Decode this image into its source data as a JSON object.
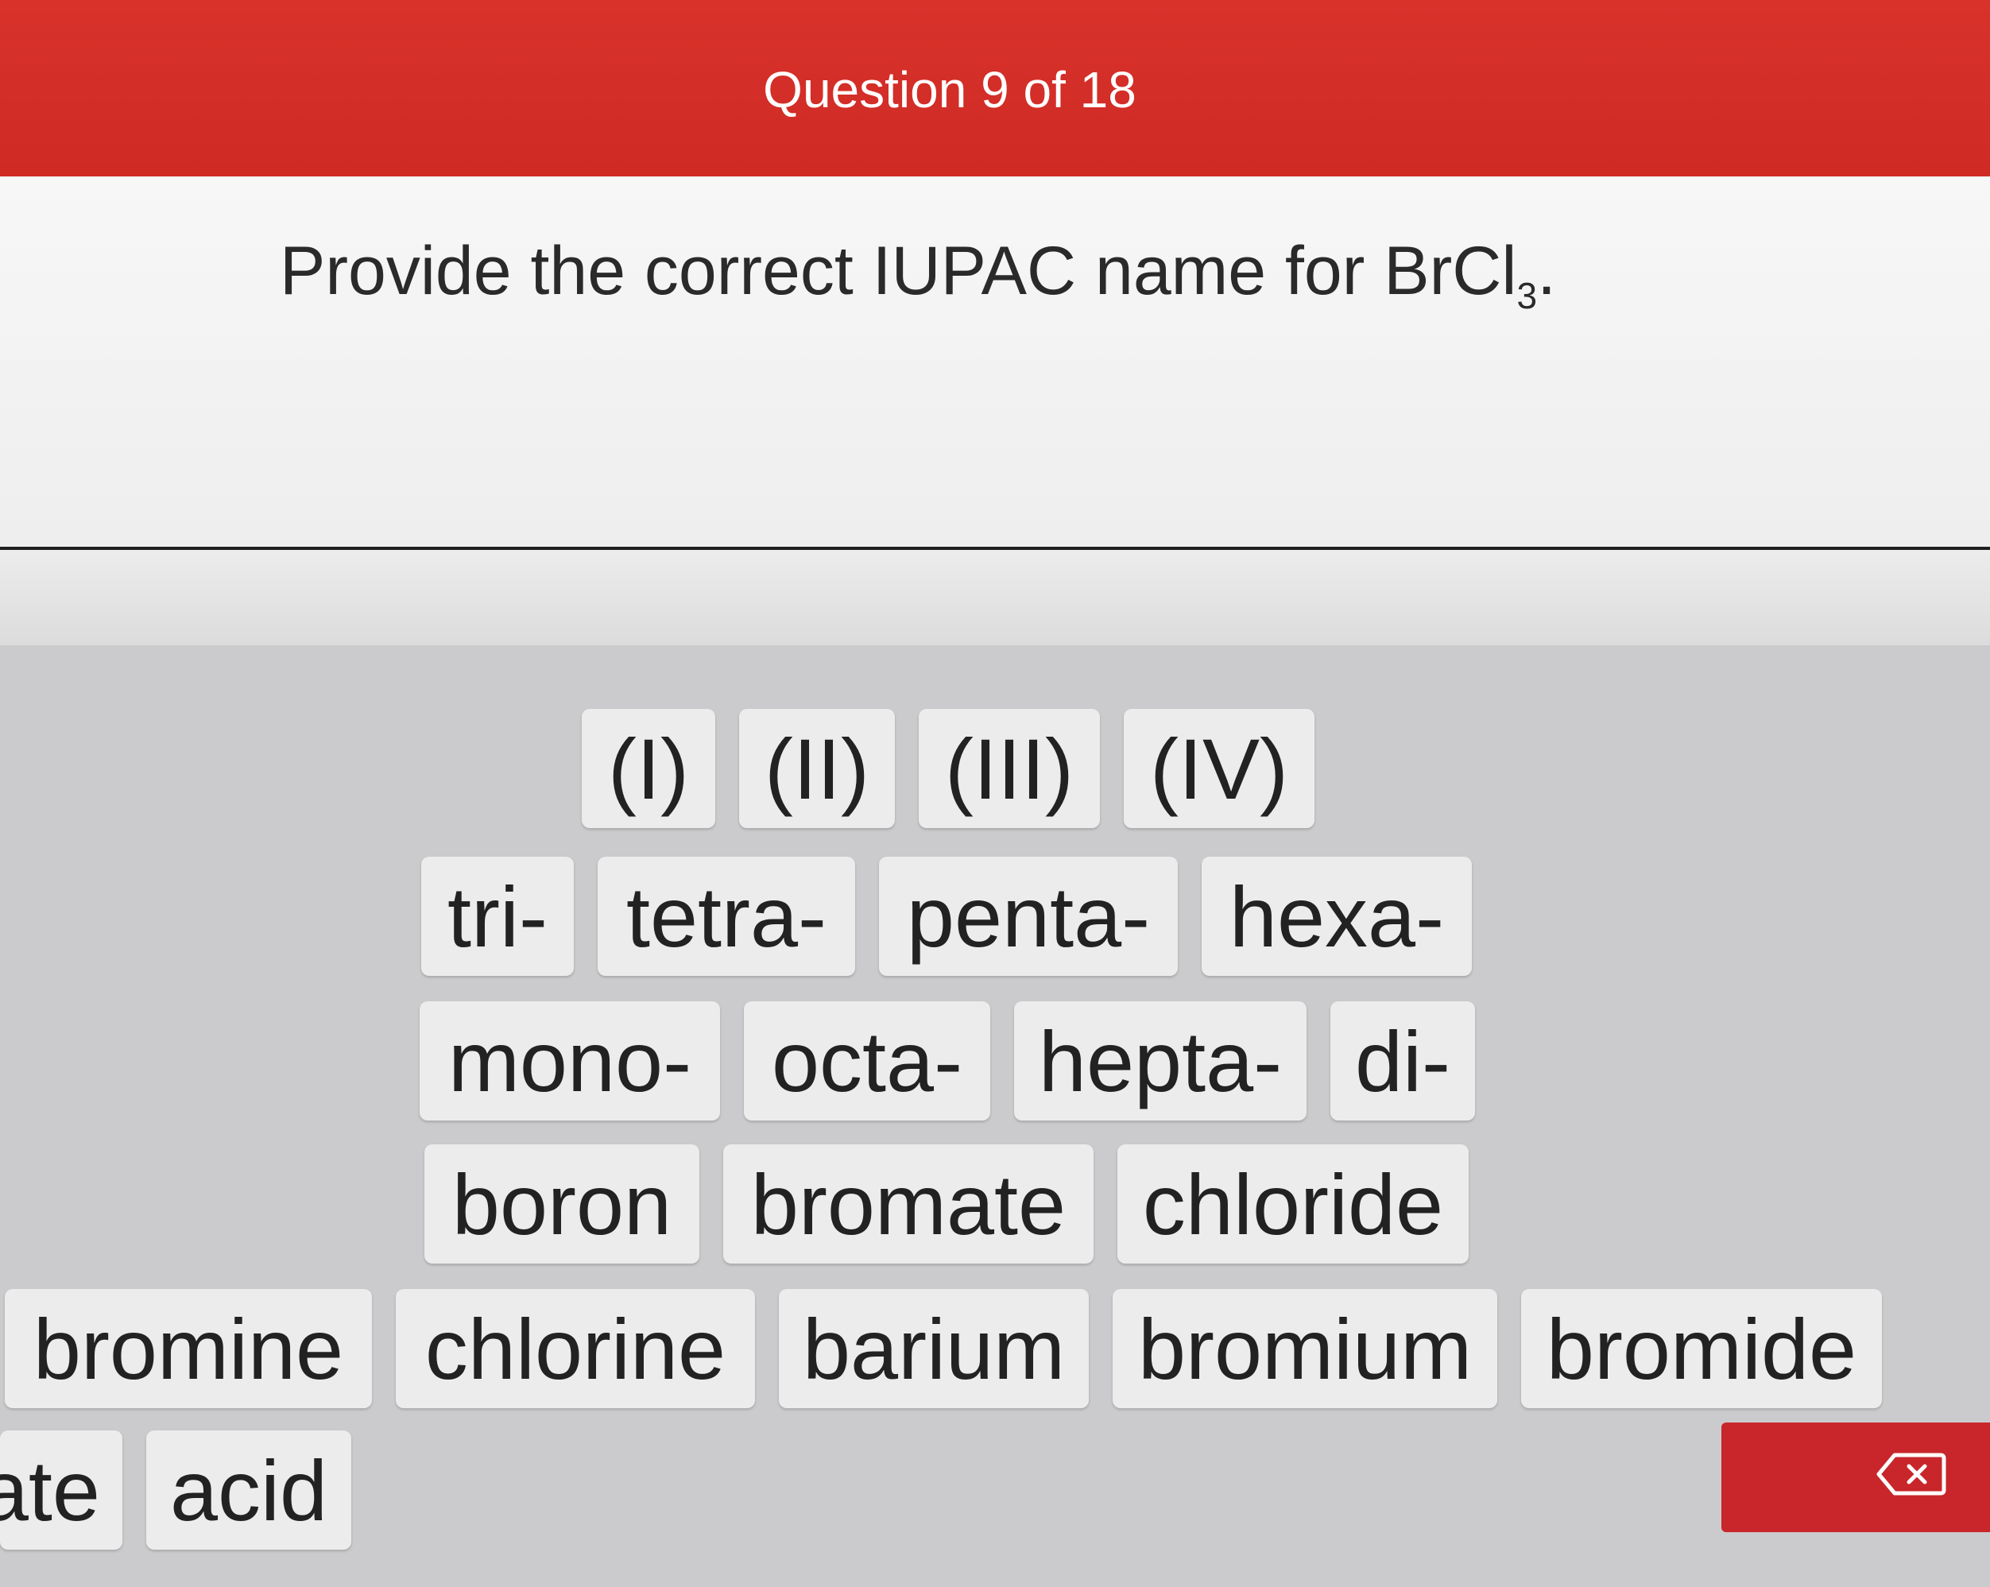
{
  "header": {
    "title": "Question 9 of 18"
  },
  "question": {
    "prompt": "Provide the correct IUPAC name for BrCl",
    "subscript": "3",
    "suffix": "."
  },
  "tiles": {
    "roman": [
      "(I)",
      "(II)",
      "(III)",
      "(IV)"
    ],
    "prefixes_row1": [
      "tri-",
      "tetra-",
      "penta-",
      "hexa-"
    ],
    "prefixes_row2": [
      "mono-",
      "octa-",
      "hepta-",
      "di-"
    ],
    "elements_row1": [
      "boron",
      "bromate",
      "chloride"
    ],
    "elements_row2": [
      "bromine",
      "chlorine",
      "barium",
      "bromium",
      "bromide"
    ],
    "misc": [
      "ate",
      "acid"
    ]
  },
  "icons": {
    "delete": "backspace-icon"
  },
  "colors": {
    "header": "#d32f2a",
    "delete_button": "#c8262a"
  }
}
